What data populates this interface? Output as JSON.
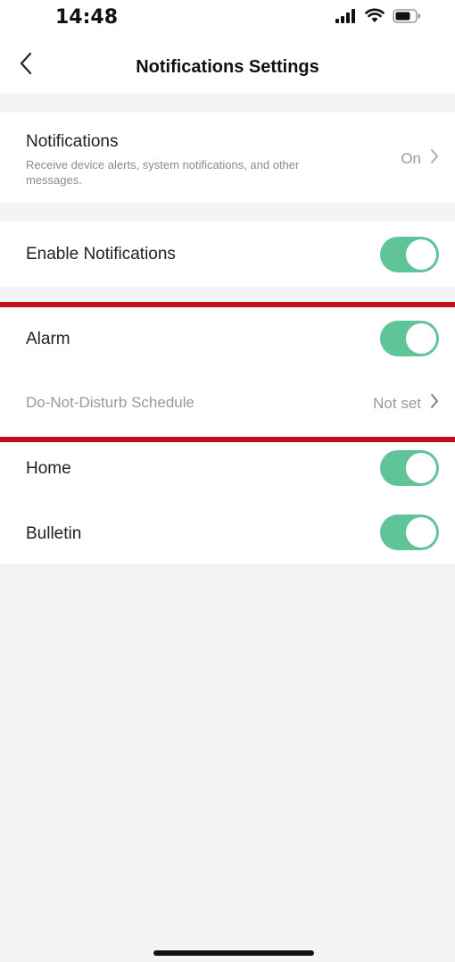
{
  "status_bar": {
    "time": "14:48",
    "icons": [
      "signal-icon",
      "wifi-icon",
      "battery-icon"
    ]
  },
  "nav": {
    "back_icon": "chevron-left-icon",
    "title": "Notifications Settings"
  },
  "notifications_row": {
    "title": "Notifications",
    "description": "Receive device alerts, system notifications, and other messages.",
    "value": "On"
  },
  "enable_row": {
    "label": "Enable Notifications",
    "toggle_on": true
  },
  "alarm_row": {
    "label": "Alarm",
    "toggle_on": true
  },
  "dnd_row": {
    "label": "Do-Not-Disturb Schedule",
    "value": "Not set"
  },
  "home_row": {
    "label": "Home",
    "toggle_on": true
  },
  "bulletin_row": {
    "label": "Bulletin",
    "toggle_on": true
  },
  "colors": {
    "toggle_on": "#5fc498",
    "highlight_line": "#c0101a",
    "background": "#f4f4f4"
  }
}
